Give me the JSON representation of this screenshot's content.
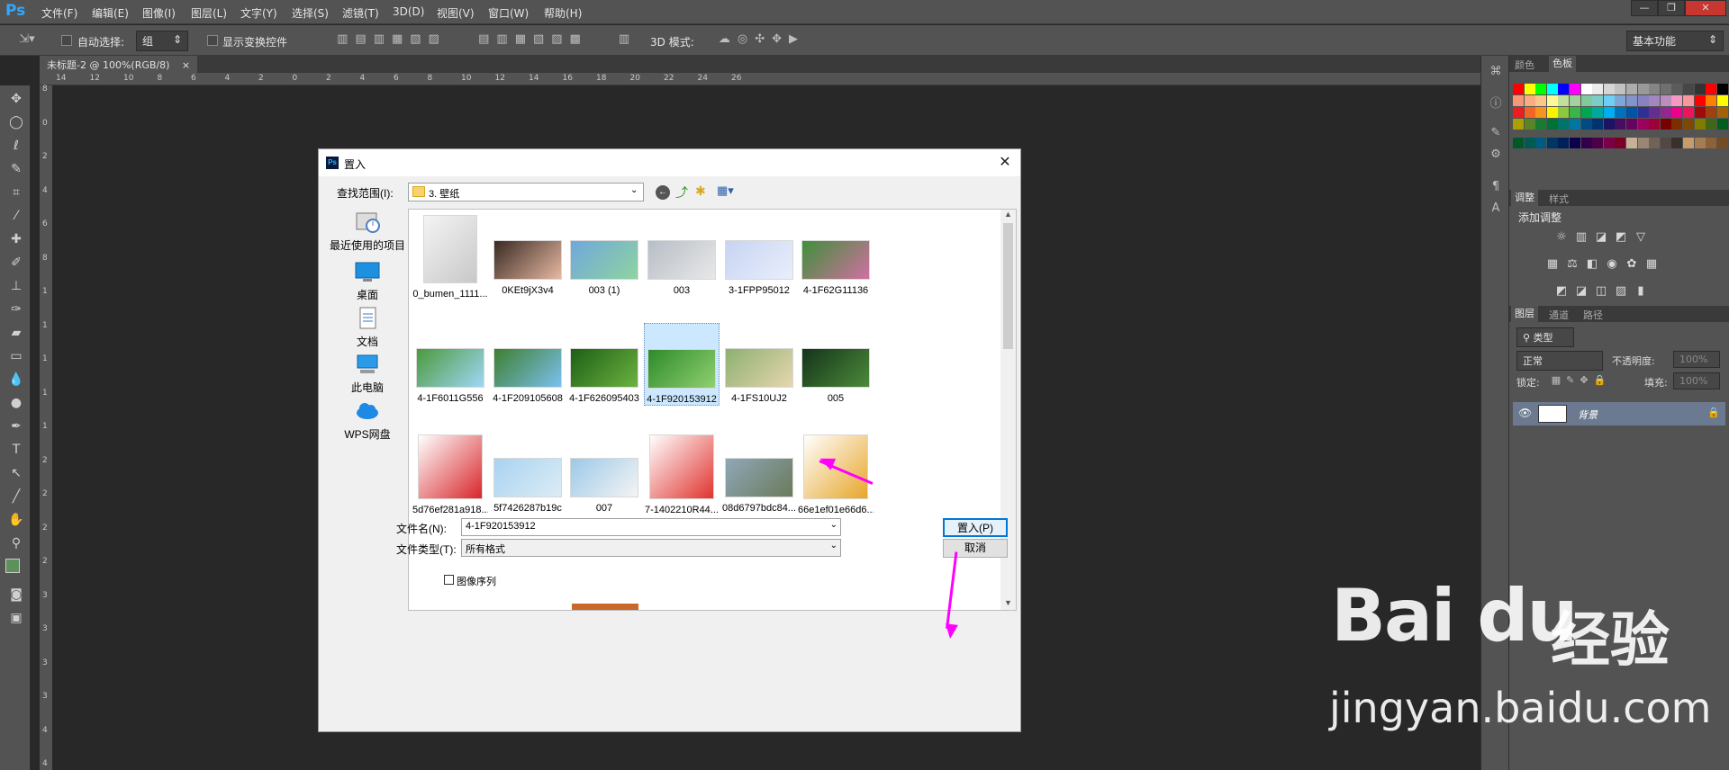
{
  "app": {
    "logo": "Ps"
  },
  "menubar": {
    "items": [
      "文件(F)",
      "编辑(E)",
      "图像(I)",
      "图层(L)",
      "文字(Y)",
      "选择(S)",
      "滤镜(T)",
      "3D(D)",
      "视图(V)",
      "窗口(W)",
      "帮助(H)"
    ]
  },
  "options": {
    "auto_select_label": "自动选择:",
    "auto_select_value": "组",
    "show_transform_label": "显示变换控件",
    "mode3d_label": "3D 模式:",
    "workspace": "基本功能"
  },
  "document_tab": {
    "title": "未标题-2 @ 100%(RGB/8)",
    "close": "×"
  },
  "ruler_numbers": [
    "14",
    "12",
    "10",
    "8",
    "6",
    "4",
    "2",
    "0",
    "2",
    "4",
    "6",
    "8",
    "10",
    "12",
    "14",
    "16",
    "18",
    "20",
    "22",
    "24",
    "26"
  ],
  "ruler_left_numbers": [
    "8",
    "0",
    "2",
    "4",
    "6",
    "8",
    "1",
    "1",
    "1",
    "1",
    "1",
    "2",
    "2",
    "2",
    "2",
    "3",
    "3",
    "3",
    "3",
    "4",
    "4"
  ],
  "right_panels": {
    "color_tabs": [
      "颜色",
      "色板"
    ],
    "adjust_tabs": [
      "调整",
      "样式"
    ],
    "adjust_title": "添加调整",
    "layer_tabs": [
      "图层",
      "通道",
      "路径"
    ],
    "layer_filter": "类型",
    "blend_mode": "正常",
    "opacity_label": "不透明度:",
    "opacity_value": "100%",
    "lock_label": "锁定:",
    "fill_label": "填充:",
    "fill_value": "100%",
    "layer_name": "背景"
  },
  "swatch_colors": [
    [
      "#ff0000",
      "#ffff00",
      "#00ff00",
      "#00ffff",
      "#0000ff",
      "#ff00ff",
      "#ffffff",
      "#ebebeb",
      "#d6d6d6",
      "#c2c2c2",
      "#adadad",
      "#999999",
      "#858585",
      "#707070",
      "#5c5c5c",
      "#474747",
      "#333333",
      "#ff0000",
      "#000000"
    ],
    [
      "#f7977a",
      "#f9ad81",
      "#fdc68a",
      "#fff79a",
      "#c4df9b",
      "#a2d39c",
      "#82ca9d",
      "#7bcdc8",
      "#6ecff6",
      "#7ea7d8",
      "#8493ca",
      "#8882be",
      "#a187be",
      "#bc8dbf",
      "#f49ac2",
      "#f6989d",
      "#ff0000",
      "#ff7f00",
      "#ffff00"
    ],
    [
      "#ed1c24",
      "#f26522",
      "#f7941d",
      "#fff200",
      "#8dc63f",
      "#39b54a",
      "#00a651",
      "#00a99d",
      "#00aeef",
      "#0072bc",
      "#0054a6",
      "#2e3192",
      "#662d91",
      "#92278f",
      "#ec008c",
      "#ed145b",
      "#9e0b0f",
      "#a0410d",
      "#a3620a"
    ],
    [
      "#aba000",
      "#598527",
      "#1a7b30",
      "#007236",
      "#00746b",
      "#0076a3",
      "#004b80",
      "#003471",
      "#1b1464",
      "#440e62",
      "#630460",
      "#9e005d",
      "#9e0039",
      "#790000",
      "#7b2e00",
      "#7d4900",
      "#827b00",
      "#406618",
      "#005e20"
    ],
    [
      "#005826",
      "#005952",
      "#005b7f",
      "#003663",
      "#002157",
      "#0d004c",
      "#32004b",
      "#4b0049",
      "#7b0046",
      "#7a0026",
      "#c7b299",
      "#998675",
      "#736357",
      "#534741",
      "#37302d",
      "#c69c6d",
      "#a67c52",
      "#8c6239",
      "#754c24"
    ]
  ],
  "dialog": {
    "title": "置入",
    "close": "✕",
    "look_in_label": "查找范围(I):",
    "look_in_value": "3. 壁纸",
    "places": [
      {
        "label": "最近使用的项目",
        "icon": "recent-items-icon"
      },
      {
        "label": "桌面",
        "icon": "desktop-icon"
      },
      {
        "label": "文档",
        "icon": "documents-icon"
      },
      {
        "label": "此电脑",
        "icon": "this-pc-icon"
      },
      {
        "label": "WPS网盘",
        "icon": "wps-cloud-icon"
      }
    ],
    "files": [
      {
        "name": "0_bumen_1111...",
        "colors": [
          "#f4f4f4",
          "#c8c8c8"
        ],
        "shape": "tall"
      },
      {
        "name": "0KEt9jX3v4",
        "colors": [
          "#3a2a22",
          "#e6b8a2"
        ],
        "shape": "wide"
      },
      {
        "name": "003 (1)",
        "colors": [
          "#6fa8dc",
          "#8fd3a0"
        ],
        "shape": "wide"
      },
      {
        "name": "003",
        "colors": [
          "#b7bec6",
          "#e8e8e8"
        ],
        "shape": "wide"
      },
      {
        "name": "3-1FPP95012",
        "colors": [
          "#c7d4f2",
          "#e9eefb"
        ],
        "shape": "wide"
      },
      {
        "name": "4-1F62G11136",
        "colors": [
          "#3f8f3a",
          "#d070a0"
        ],
        "shape": "wide"
      },
      {
        "name": "4-1F6011G556",
        "colors": [
          "#4b9a3c",
          "#9fd7f6"
        ],
        "shape": "wide"
      },
      {
        "name": "4-1F209105608",
        "colors": [
          "#3d7f2e",
          "#7cc0f0"
        ],
        "shape": "wide"
      },
      {
        "name": "4-1F626095403",
        "colors": [
          "#1d5f16",
          "#6cb240"
        ],
        "shape": "wide"
      },
      {
        "name": "4-1F920153912",
        "colors": [
          "#2f8a2a",
          "#8fd070"
        ],
        "shape": "wide"
      },
      {
        "name": "4-1FS10UJ2",
        "colors": [
          "#8db070",
          "#e6d6b0"
        ],
        "shape": "wide"
      },
      {
        "name": "005",
        "colors": [
          "#14341a",
          "#4c8a3a"
        ],
        "shape": "wide"
      },
      {
        "name": "5d76ef281a918...",
        "colors": [
          "#ffffff",
          "#d8262a"
        ],
        "shape": "square"
      },
      {
        "name": "5f7426287b19c",
        "colors": [
          "#a9d3f0",
          "#dcecf6"
        ],
        "shape": "wide"
      },
      {
        "name": "007",
        "colors": [
          "#9cc9e8",
          "#f4f4f4"
        ],
        "shape": "wide"
      },
      {
        "name": "7-1402210R44...",
        "colors": [
          "#ffffff",
          "#e0332e"
        ],
        "shape": "square"
      },
      {
        "name": "08d6797bdc84...",
        "colors": [
          "#8fa8b8",
          "#6a7a5a"
        ],
        "shape": "wide"
      },
      {
        "name": "66e1ef01e66d6...",
        "colors": [
          "#ffffff",
          "#e7a62a"
        ],
        "shape": "square"
      }
    ],
    "filename_label": "文件名(N):",
    "filename_value": "4-1F920153912",
    "filetype_label": "文件类型(T):",
    "filetype_value": "所有格式",
    "place_button": "置入(P)",
    "cancel_button": "取消",
    "image_sequence_label": "图像序列"
  },
  "watermark": {
    "logo": "Bai du",
    "cn": "经验",
    "url": "jingyan.baidu.com"
  }
}
